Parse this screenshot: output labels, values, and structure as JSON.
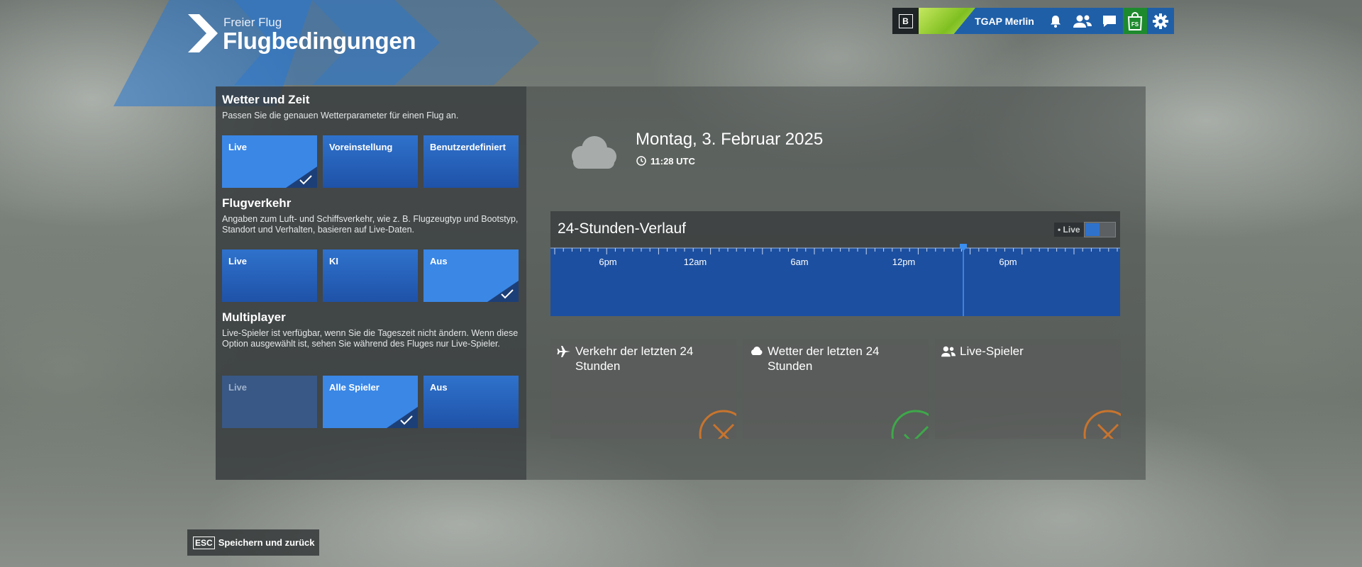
{
  "header": {
    "subtitle": "Freier Flug",
    "title": "Flugbedingungen"
  },
  "topbar": {
    "badge": "B",
    "username": "TGAP Merlin",
    "icons": [
      "bell-icon",
      "friends-icon",
      "chat-icon",
      "shop-icon",
      "gear-icon"
    ],
    "shop_label": "FS"
  },
  "weather_time": {
    "title": "Wetter und Zeit",
    "description": "Passen Sie die genauen Wetterparameter für einen Flug an.",
    "options": [
      "Live",
      "Voreinstellung",
      "Benutzerdefiniert"
    ],
    "selected": "Live"
  },
  "traffic": {
    "title": "Flugverkehr",
    "description": "Angaben zum Luft- und Schiffsverkehr, wie z. B. Flugzeugtyp und Bootstyp, Standort und Verhalten, basieren auf Live-Daten.",
    "options": [
      "Live",
      "KI",
      "Aus"
    ],
    "selected": "Aus"
  },
  "multiplayer": {
    "title": "Multiplayer",
    "description": "Live-Spieler ist verfügbar, wenn Sie die Tageszeit nicht ändern. Wenn diese Option ausgewählt ist, sehen Sie während des Fluges nur Live-Spieler.",
    "options": [
      "Live",
      "Alle Spieler",
      "Aus"
    ],
    "selected": "Alle Spieler",
    "disabled": [
      "Live"
    ]
  },
  "weather_summary": {
    "icon": "cloud-icon",
    "date": "Montag, 3. Februar 2025",
    "time": "11:28 UTC"
  },
  "timeline": {
    "title": "24-Stunden-Verlauf",
    "live_label": "• Live",
    "ticks": [
      "6pm",
      "12am",
      "6am",
      "12pm",
      "6pm"
    ]
  },
  "cards": [
    {
      "icon": "airplane-icon",
      "title": "Verkehr der letzten 24 Stunden",
      "status": "unavailable"
    },
    {
      "icon": "cloud-icon",
      "title": "Wetter der letzten 24 Stunden",
      "status": "available"
    },
    {
      "icon": "players-icon",
      "title": "Live-Spieler",
      "status": "unavailable"
    }
  ],
  "footer": {
    "key": "ESC",
    "label": "Speichern und zurück"
  },
  "colors": {
    "accent": "#3a87e6",
    "option": "#1f52a8",
    "unavailable": "#c8742e",
    "available": "#3ea84a"
  }
}
